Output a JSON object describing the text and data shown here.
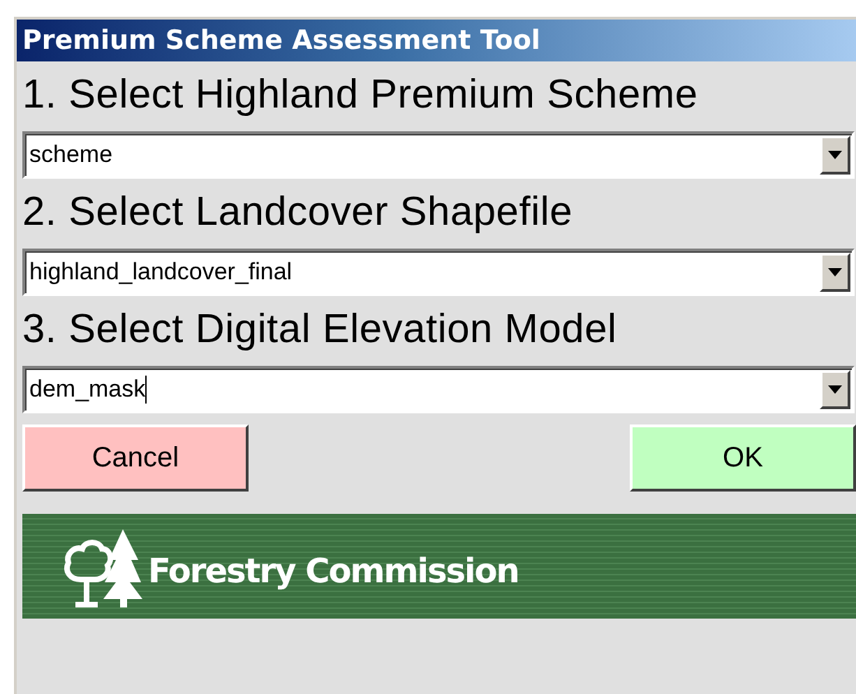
{
  "window": {
    "title": "Premium Scheme Assessment Tool"
  },
  "steps": [
    {
      "label": "1. Select Highland Premium Scheme",
      "value": "scheme",
      "focused": false
    },
    {
      "label": "2. Select Landcover Shapefile",
      "value": "highland_landcover_final",
      "focused": false
    },
    {
      "label": "3. Select Digital Elevation Model",
      "value": "dem_mask",
      "focused": true
    }
  ],
  "buttons": [
    {
      "label": "Cancel",
      "kind": "cancel"
    },
    {
      "label": "OK",
      "kind": "ok"
    }
  ],
  "banner": {
    "text": "Forestry Commission"
  }
}
